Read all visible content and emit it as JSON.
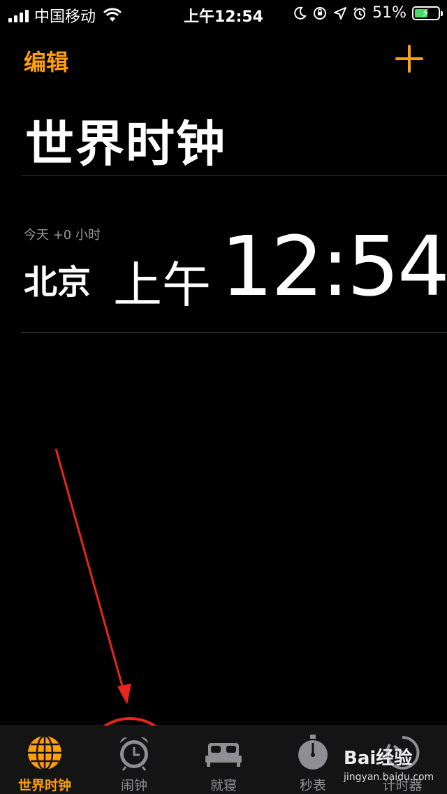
{
  "status_bar": {
    "carrier": "中国移动",
    "time": "上午12:54",
    "battery": "51%",
    "battery_level": 0.51
  },
  "nav": {
    "edit_label": "编辑",
    "add_icon": "plus-icon"
  },
  "page_title": "世界时钟",
  "clocks": [
    {
      "offset": "今天 +0 小时",
      "city": "北京",
      "ampm": "上午",
      "time": "12:54"
    }
  ],
  "tabs": [
    {
      "label": "世界时钟",
      "icon": "globe-icon",
      "active": true
    },
    {
      "label": "闹钟",
      "icon": "alarm-clock-icon",
      "active": false
    },
    {
      "label": "就寝",
      "icon": "bed-icon",
      "active": false
    },
    {
      "label": "秒表",
      "icon": "stopwatch-icon",
      "active": false
    },
    {
      "label": "计时器",
      "icon": "timer-icon",
      "active": false
    }
  ],
  "watermark": {
    "main": "Bai经验",
    "sub": "jingyan.baidu.com"
  },
  "colors": {
    "accent": "#ff9f0a",
    "inactive": "#8e8e93",
    "annotation": "#e8261c"
  }
}
